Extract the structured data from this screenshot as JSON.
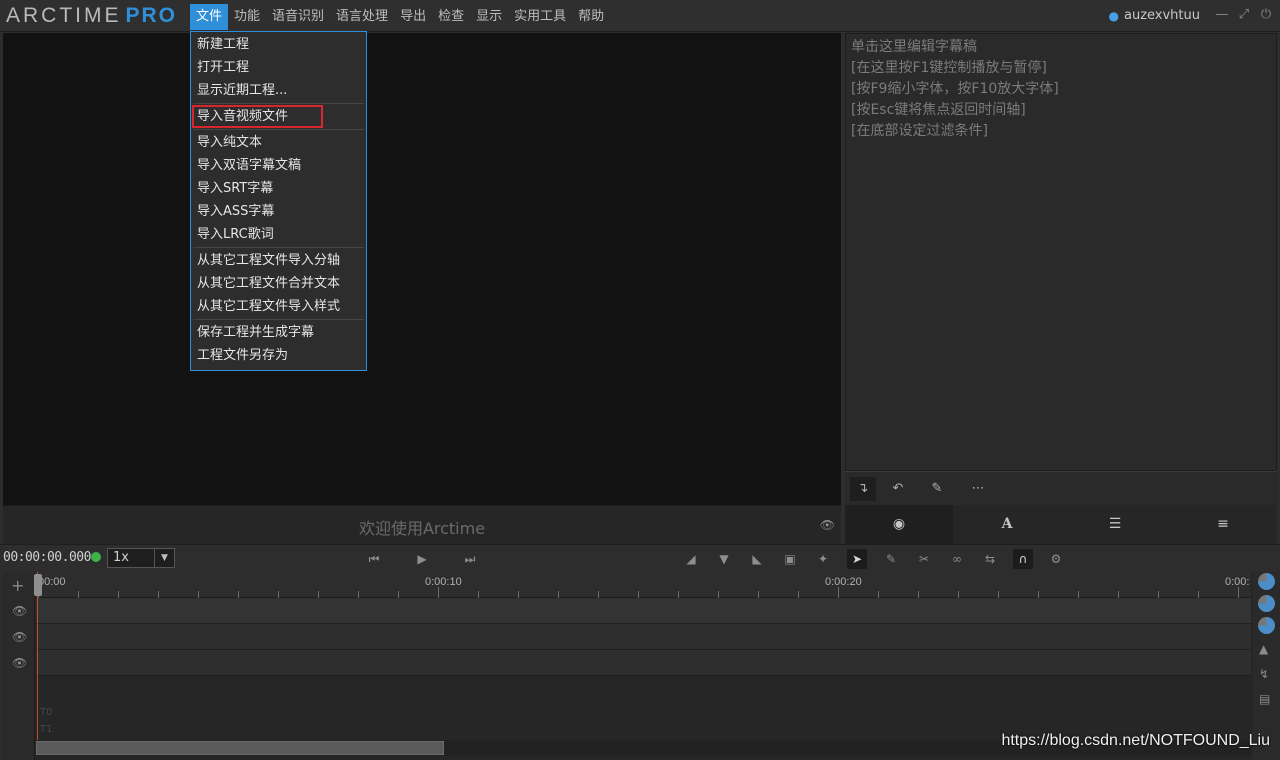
{
  "app": {
    "logo_main": "ARCTIME",
    "logo_pro": "PRO",
    "username": "auzexvhtuu"
  },
  "menubar": {
    "items": [
      "文件",
      "功能",
      "语音识别",
      "语言处理",
      "导出",
      "检查",
      "显示",
      "实用工具",
      "帮助"
    ],
    "active_index": 0
  },
  "window_controls": [
    "minimize-icon",
    "restore-icon",
    "power-icon"
  ],
  "file_menu": {
    "groups": [
      [
        "新建工程",
        "打开工程",
        "显示近期工程..."
      ],
      [
        "导入音视频文件"
      ],
      [
        "导入纯文本",
        "导入双语字幕文稿",
        "导入SRT字幕",
        "导入ASS字幕",
        "导入LRC歌词"
      ],
      [
        "从其它工程文件导入分轴",
        "从其它工程文件合并文本",
        "从其它工程文件导入样式"
      ],
      [
        "保存工程并生成字幕",
        "工程文件另存为"
      ]
    ],
    "highlighted": "导入音视频文件"
  },
  "video": {
    "welcome": "欢迎使用Arctime"
  },
  "editor": {
    "lines": [
      "单击这里编辑字幕稿",
      "[在这里按F1键控制播放与暂停]",
      "[按F9缩小字体，按F10放大字体]",
      "[按Esc键将焦点返回时间轴]",
      "[在底部设定过滤条件]"
    ],
    "tools": [
      "insert-icon",
      "undo-icon",
      "pencil-icon",
      "more-icon"
    ],
    "tabs": [
      "chat-icon",
      "font-icon",
      "list-icon",
      "sliders-icon"
    ]
  },
  "controls": {
    "timecode": "00:00:00.000",
    "speed": "1x",
    "status_color": "#3db34a"
  },
  "timeline": {
    "tick_labels": [
      "00:00",
      "0:00:10",
      "0:00:20",
      "0:00:"
    ],
    "track_count": 3,
    "faint_labels": [
      "T0",
      "T1"
    ]
  },
  "watermark": "https://blog.csdn.net/NOTFOUND_Liu",
  "colors": {
    "accent": "#2f8fd8",
    "highlight_border": "#d9252c",
    "playhead": "#c24a2a"
  }
}
